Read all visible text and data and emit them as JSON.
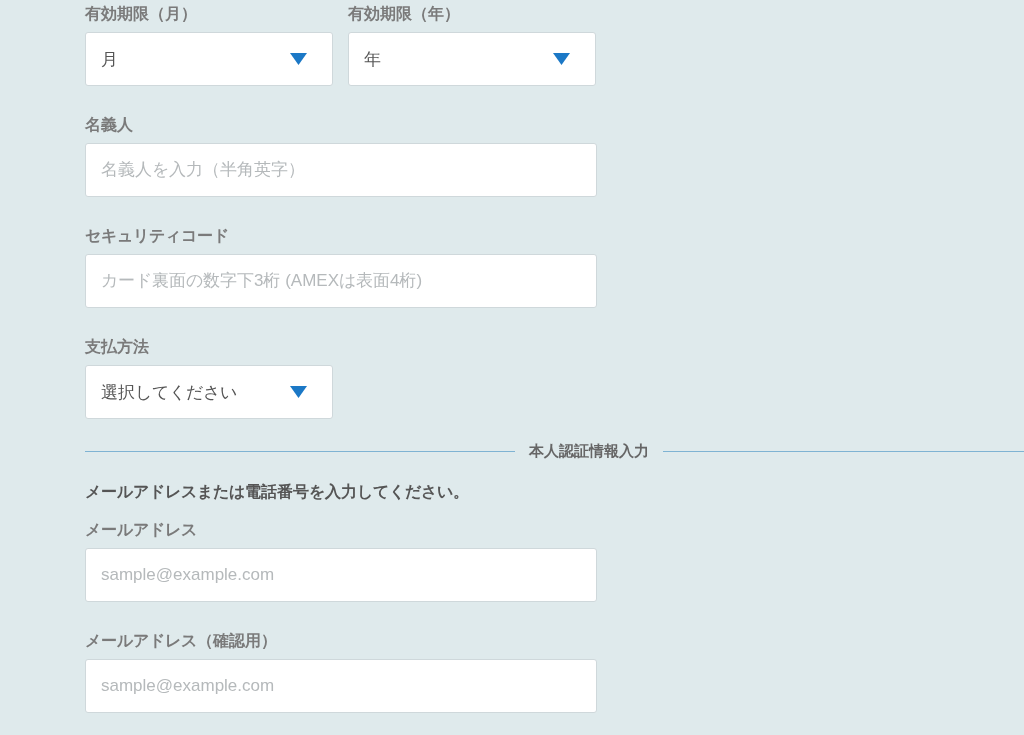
{
  "payment_rows": [
    [
      {
        "kind": "select",
        "label": "有効期限（月）",
        "value": "月"
      },
      {
        "kind": "select",
        "label": "有効期限（年）",
        "value": "年"
      }
    ],
    [
      {
        "kind": "text",
        "label": "名義人",
        "placeholder": "名義人を入力（半角英字）"
      }
    ],
    [
      {
        "kind": "text",
        "label": "セキュリティコード",
        "placeholder": "カード裏面の数字下3桁 (AMEXは表面4桁)"
      }
    ],
    [
      {
        "kind": "select",
        "label": "支払方法",
        "value": "選択してください"
      }
    ]
  ],
  "divider": {
    "title": "本人認証情報入力"
  },
  "instruction": "メールアドレスまたは電話番号を入力してください。",
  "contact_rows": [
    [
      {
        "kind": "text",
        "label": "メールアドレス",
        "placeholder": "sample@example.com"
      }
    ],
    [
      {
        "kind": "text",
        "label": "メールアドレス（確認用）",
        "placeholder": "sample@example.com"
      }
    ]
  ]
}
